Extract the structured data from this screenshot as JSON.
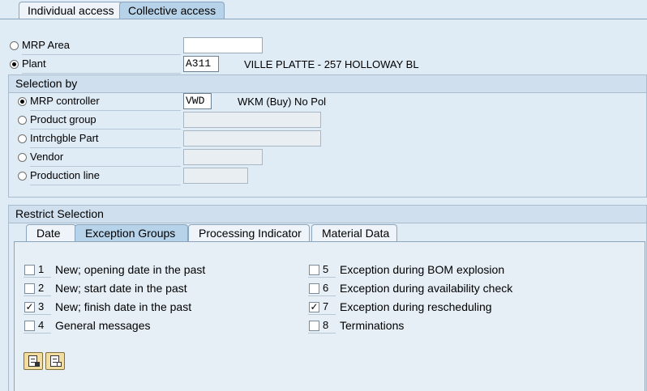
{
  "top_tabs": [
    {
      "label": "Individual access",
      "active": false
    },
    {
      "label": "Collective access",
      "active": true
    }
  ],
  "scope": {
    "mrp_area": {
      "label": "MRP Area",
      "selected": false,
      "value": ""
    },
    "plant": {
      "label": "Plant",
      "selected": true,
      "value": "A311",
      "description": "VILLE PLATTE - 257 HOLLOWAY BL"
    }
  },
  "selection_by": {
    "title": "Selection by",
    "items": [
      {
        "label": "MRP controller",
        "selected": true,
        "value": "VWD",
        "description": "WKM (Buy) No Pol"
      },
      {
        "label": "Product group",
        "selected": false,
        "value": ""
      },
      {
        "label": "Intrchgble Part",
        "selected": false,
        "value": ""
      },
      {
        "label": "Vendor",
        "selected": false,
        "value": ""
      },
      {
        "label": "Production line",
        "selected": false,
        "value": ""
      }
    ]
  },
  "restrict": {
    "title": "Restrict Selection",
    "tabs": [
      {
        "label": "Date",
        "active": false
      },
      {
        "label": "Exception Groups",
        "active": true
      },
      {
        "label": "Processing Indicator",
        "active": false
      },
      {
        "label": "Material Data",
        "active": false
      }
    ],
    "exceptions": [
      {
        "num": "1",
        "label": "New; opening date in the past",
        "checked": false
      },
      {
        "num": "2",
        "label": "New; start date in the past",
        "checked": false
      },
      {
        "num": "3",
        "label": "New; finish date in the past",
        "checked": true
      },
      {
        "num": "4",
        "label": "General messages",
        "checked": false
      },
      {
        "num": "5",
        "label": "Exception during BOM explosion",
        "checked": false
      },
      {
        "num": "6",
        "label": "Exception during availability check",
        "checked": false
      },
      {
        "num": "7",
        "label": "Exception during rescheduling",
        "checked": true
      },
      {
        "num": "8",
        "label": "Terminations",
        "checked": false
      }
    ],
    "buttons": [
      {
        "icon": "select-all-icon"
      },
      {
        "icon": "deselect-all-icon"
      }
    ]
  }
}
